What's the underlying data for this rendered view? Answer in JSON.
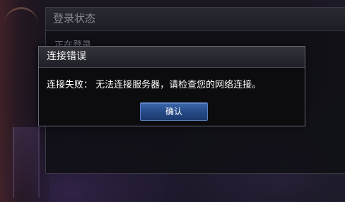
{
  "status_panel": {
    "title": "登录状态",
    "message": "正在登录……"
  },
  "error_dialog": {
    "title": "连接错误",
    "message": "连接失败： 无法连接服务器，请检查您的网络连接。",
    "confirm_label": "确认"
  },
  "colors": {
    "button_blue": "#284d8b",
    "dialog_border": "#6b6b78",
    "text_white": "#ffffff"
  }
}
